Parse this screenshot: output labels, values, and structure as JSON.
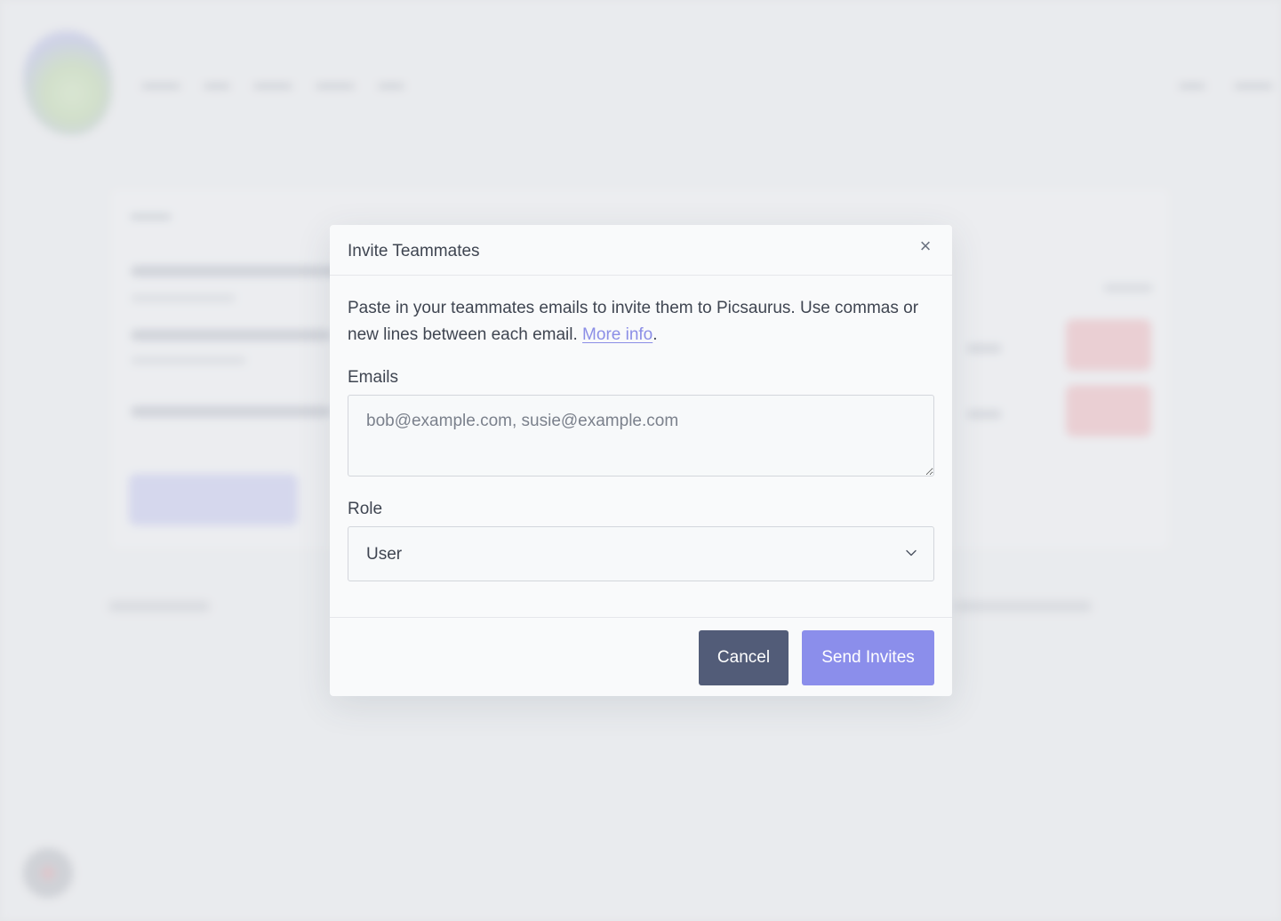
{
  "modal": {
    "title": "Invite Teammates",
    "close_symbol": "×",
    "intro_text": "Paste in your teammates emails to invite them to Picsaurus. Use commas or new lines between each email.",
    "more_info_label": "More info",
    "intro_end": ".",
    "emails_label": "Emails",
    "emails_value": "",
    "emails_placeholder": "bob@example.com, susie@example.com",
    "role_label": "Role",
    "role_selected": "User",
    "cancel_label": "Cancel",
    "send_label": "Send Invites"
  },
  "icons": {
    "close": "close-icon",
    "chevron": "chevron-down-icon"
  },
  "colors": {
    "primary": "#8b8eeb",
    "secondary": "#525c78",
    "link": "#8b8ee6",
    "danger_blurred": "#f3b6bb"
  }
}
